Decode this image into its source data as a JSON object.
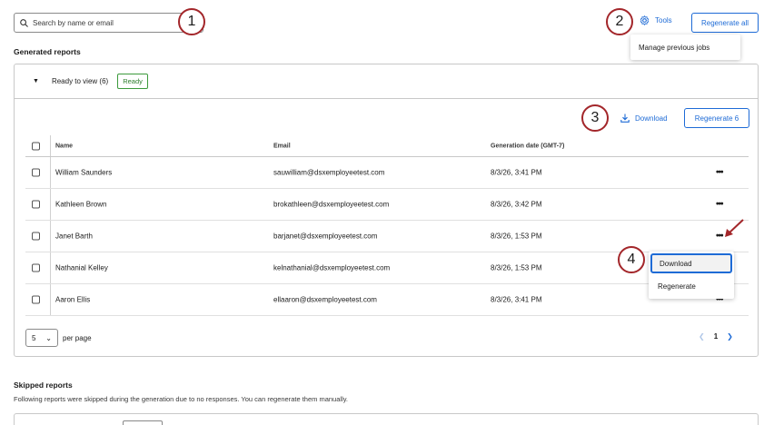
{
  "search": {
    "placeholder": "Search by name or email"
  },
  "callouts": [
    "1",
    "2",
    "3",
    "4"
  ],
  "toolbar": {
    "tools_label": "Tools",
    "regenerate_all_label": "Regenerate all",
    "tools_menu_item": "Manage previous jobs"
  },
  "generated": {
    "title": "Generated reports",
    "group_label": "Ready to view (6)",
    "badge": "Ready",
    "download_label": "Download",
    "regenerate_label": "Regenerate 6",
    "columns": {
      "name": "Name",
      "email": "Email",
      "date": "Generation date (GMT-7)"
    },
    "rows": [
      {
        "name": "William Saunders",
        "email": "sauwilliam@dsxemployeetest.com",
        "date": "8/3/26, 3:41 PM",
        "more": "•••"
      },
      {
        "name": "Kathleen Brown",
        "email": "brokathleen@dsxemployeetest.com",
        "date": "8/3/26, 3:42 PM",
        "more": "•••"
      },
      {
        "name": "Janet Barth",
        "email": "barjanet@dsxemployeetest.com",
        "date": "8/3/26, 1:53 PM",
        "more": "•••"
      },
      {
        "name": "Nathanial Kelley",
        "email": "kelnathanial@dsxemployeetest.com",
        "date": "8/3/26, 1:53 PM",
        "more": ""
      },
      {
        "name": "Aaron Ellis",
        "email": "ellaaron@dsxemployeetest.com",
        "date": "8/3/26, 3:41 PM",
        "more": "•••"
      }
    ],
    "row_menu": {
      "download": "Download",
      "regenerate": "Regenerate"
    },
    "per_page_value": "5",
    "per_page_label": "per page",
    "page_number": "1"
  },
  "skipped": {
    "title": "Skipped reports",
    "description": "Following reports were skipped during the generation due to no responses. You can regenerate them manually."
  },
  "colors": {
    "accent": "#1e6bd6",
    "callout": "#a3262a",
    "ready": "#3c9a3c"
  }
}
